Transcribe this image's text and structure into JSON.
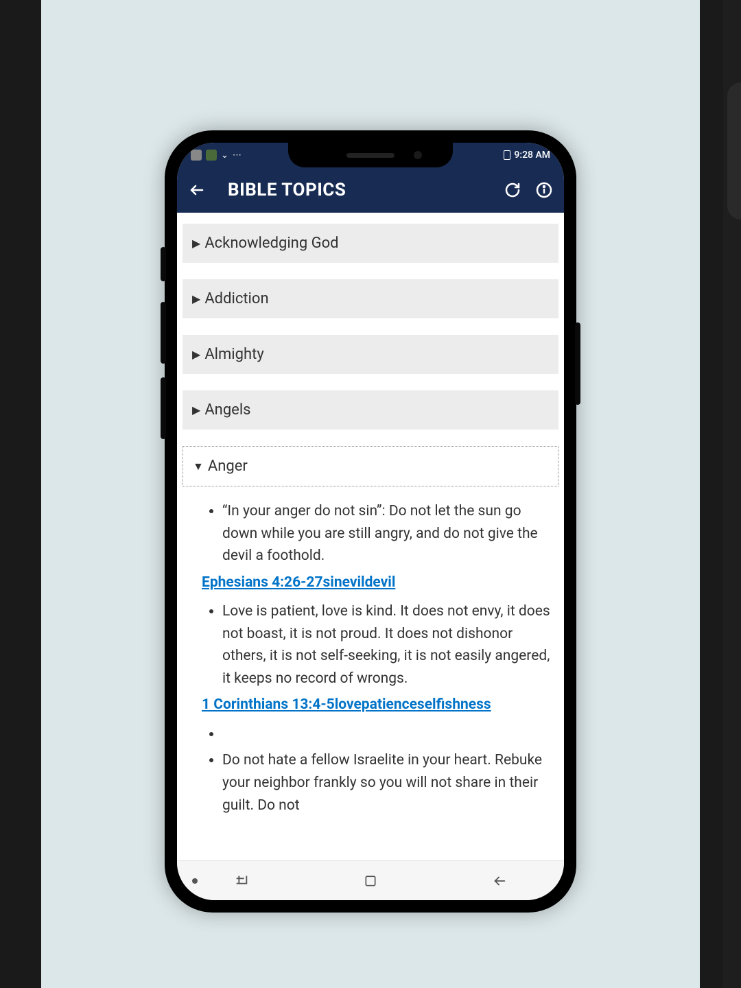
{
  "statusbar": {
    "time": "9:28 AM"
  },
  "appbar": {
    "title": "BIBLE TOPICS"
  },
  "topics": {
    "collapsed": [
      "Acknowledging God",
      "Addiction",
      "Almighty",
      "Angels"
    ],
    "expanded": {
      "title": "Anger",
      "items": [
        {
          "text": "“In your anger do not sin”: Do not let the sun go down while you are still angry, and do not give the devil a foothold.",
          "link": "Ephesians 4:26-27sinevildevil"
        },
        {
          "text": "Love is patient, love is kind. It does not envy, it does not boast, it is not proud. It does not dishonor others, it is not self-seeking, it is not easily angered, it keeps no record of wrongs.",
          "link": "1 Corinthians 13:4-5lovepatienceselfishness"
        },
        {
          "text": "",
          "link": ""
        },
        {
          "text": "Do not hate a fellow Israelite in your heart. Rebuke your neighbor frankly so you will not share in their guilt. Do not",
          "link": ""
        }
      ]
    }
  }
}
